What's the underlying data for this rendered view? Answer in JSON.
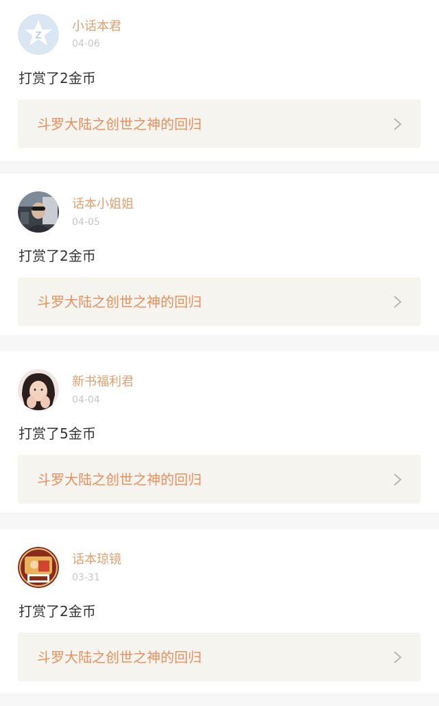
{
  "entries": [
    {
      "user": "小话本君",
      "date": "04-06",
      "action": "打赏了2金币",
      "book": "斗罗大陆之创世之神的回归",
      "avatar_icon": "star-logo-avatar"
    },
    {
      "user": "话本小姐姐",
      "date": "04-05",
      "action": "打赏了2金币",
      "book": "斗罗大陆之创世之神的回归",
      "avatar_icon": "photo-avatar"
    },
    {
      "user": "新书福利君",
      "date": "04-04",
      "action": "打赏了5金币",
      "book": "斗罗大陆之创世之神的回归",
      "avatar_icon": "photo-avatar"
    },
    {
      "user": "话本琼镜",
      "date": "03-31",
      "action": "打赏了2金币",
      "book": "斗罗大陆之创世之神的回归",
      "avatar_icon": "cartoon-avatar"
    }
  ],
  "colors": {
    "accent": "#e8905c",
    "name": "#e0a070",
    "date": "#c6c6c6",
    "text": "#333333",
    "link_bg": "#f5f4ef",
    "page_bg": "#f7f7f7"
  }
}
